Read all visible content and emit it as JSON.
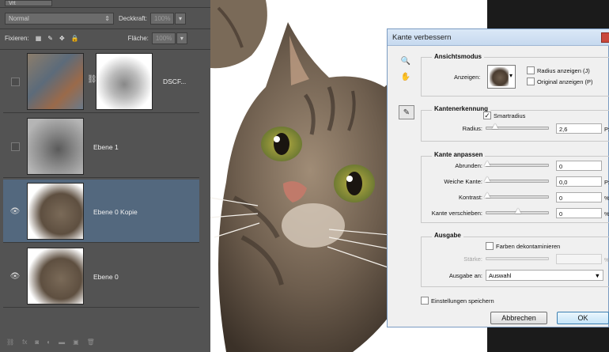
{
  "layers_panel": {
    "mode_top": "Vrt",
    "blend_mode": "Normal",
    "opacity_label": "Deckkraft:",
    "opacity_value": "100%",
    "lock_label": "Fixieren:",
    "fill_label": "Fläche:",
    "fill_value": "100%",
    "layers": [
      {
        "name": "DSCF...",
        "visible": false,
        "selected": false,
        "has_mask": true
      },
      {
        "name": "Ebene 1",
        "visible": false,
        "selected": false,
        "has_mask": false
      },
      {
        "name": "Ebene 0 Kopie",
        "visible": true,
        "selected": true,
        "has_mask": false
      },
      {
        "name": "Ebene 0",
        "visible": true,
        "selected": false,
        "has_mask": false
      }
    ],
    "footer_icons": [
      "link-icon",
      "fx-icon",
      "mask-icon",
      "adjustment-icon",
      "group-icon",
      "new-layer-icon",
      "trash-icon"
    ],
    "selection_color": "#53687e"
  },
  "dialog": {
    "title": "Kante verbessern",
    "ansichtsmodus": {
      "title": "Ansichtsmodus",
      "anzeigen_label": "Anzeigen:",
      "radius_anzeigen": "Radius anzeigen (J)",
      "original_anzeigen": "Original anzeigen (P)"
    },
    "kantenerkennung": {
      "title": "Kantenerkennung",
      "smartradius": "Smartradius",
      "smartradius_checked": true,
      "radius_label": "Radius:",
      "radius_value": "2,6",
      "radius_unit": "Px",
      "radius_level": 0.12
    },
    "kante_anpassen": {
      "title": "Kante anpassen",
      "rows": [
        {
          "label": "Abrunden:",
          "value": "0",
          "unit": "",
          "level": 0.0
        },
        {
          "label": "Weiche Kante:",
          "value": "0,0",
          "unit": "Px",
          "level": 0.0
        },
        {
          "label": "Kontrast:",
          "value": "0",
          "unit": "%",
          "level": 0.0
        },
        {
          "label": "Kante verschieben:",
          "value": "0",
          "unit": "%",
          "level": 0.5
        }
      ]
    },
    "ausgabe": {
      "title": "Ausgabe",
      "farben_dekontaminieren": "Farben dekontaminieren",
      "staerke_label": "Stärke:",
      "staerke_unit": "%",
      "ausgabe_an_label": "Ausgabe an:",
      "ausgabe_an_value": "Auswahl"
    },
    "einstellungen_speichern": "Einstellungen speichern",
    "cancel_label": "Abbrechen",
    "ok_label": "OK"
  }
}
